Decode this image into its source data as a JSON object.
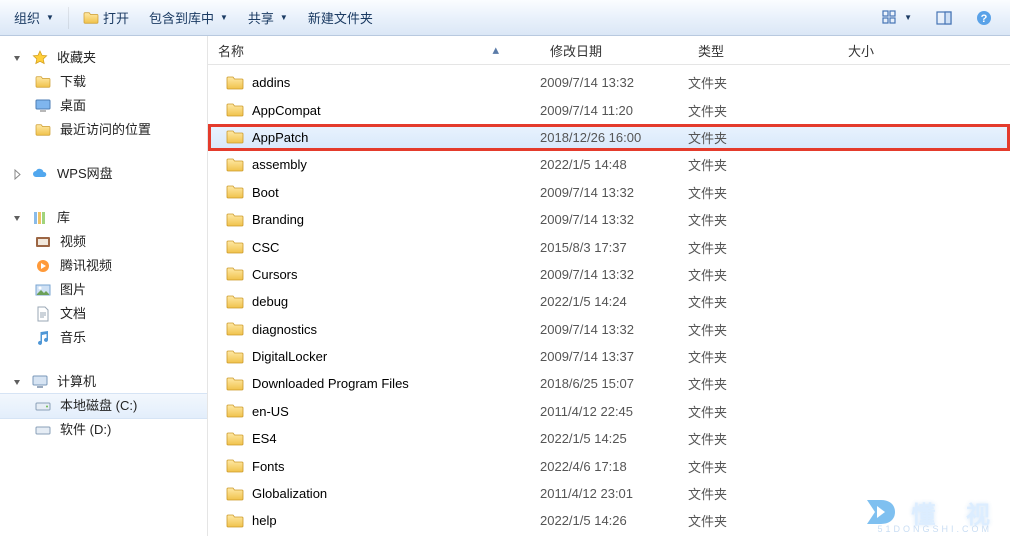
{
  "toolbar": {
    "organize": "组织",
    "open": "打开",
    "include": "包含到库中",
    "share": "共享",
    "newfolder": "新建文件夹"
  },
  "nav": {
    "fav": {
      "label": "收藏夹",
      "items": {
        "downloads": "下载",
        "desktop": "桌面",
        "recent": "最近访问的位置"
      }
    },
    "wps": "WPS网盘",
    "lib": {
      "label": "库",
      "items": {
        "video": "视频",
        "tencent": "腾讯视频",
        "pictures": "图片",
        "docs": "文档",
        "music": "音乐"
      }
    },
    "pc": {
      "label": "计算机",
      "items": {
        "c": "本地磁盘 (C:)",
        "d": "软件 (D:)"
      }
    }
  },
  "columns": {
    "name": "名称",
    "date": "修改日期",
    "type": "类型",
    "size": "大小"
  },
  "type_folder": "文件夹",
  "rows": [
    {
      "name": "addins",
      "date": "2009/7/14 13:32"
    },
    {
      "name": "AppCompat",
      "date": "2009/7/14 11:20"
    },
    {
      "name": "AppPatch",
      "date": "2018/12/26 16:00",
      "selected": true,
      "highlight": true
    },
    {
      "name": "assembly",
      "date": "2022/1/5 14:48"
    },
    {
      "name": "Boot",
      "date": "2009/7/14 13:32"
    },
    {
      "name": "Branding",
      "date": "2009/7/14 13:32"
    },
    {
      "name": "CSC",
      "date": "2015/8/3 17:37"
    },
    {
      "name": "Cursors",
      "date": "2009/7/14 13:32"
    },
    {
      "name": "debug",
      "date": "2022/1/5 14:24"
    },
    {
      "name": "diagnostics",
      "date": "2009/7/14 13:32"
    },
    {
      "name": "DigitalLocker",
      "date": "2009/7/14 13:37"
    },
    {
      "name": "Downloaded Program Files",
      "date": "2018/6/25 15:07"
    },
    {
      "name": "en-US",
      "date": "2011/4/12 22:45"
    },
    {
      "name": "ES4",
      "date": "2022/1/5 14:25"
    },
    {
      "name": "Fonts",
      "date": "2022/4/6 17:18"
    },
    {
      "name": "Globalization",
      "date": "2011/4/12 23:01"
    },
    {
      "name": "help",
      "date": "2022/1/5 14:26"
    }
  ],
  "watermark": {
    "brand": "懂 视",
    "sub": "51DONGSHI.COM"
  }
}
